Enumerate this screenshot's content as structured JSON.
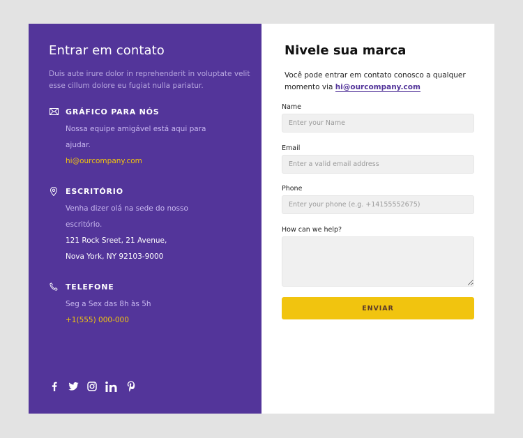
{
  "left": {
    "title": "Entrar em contato",
    "intro": "Duis aute irure dolor in reprehenderit in voluptate velit esse cillum dolore eu fugiat nulla pariatur.",
    "sections": [
      {
        "icon": "mail-icon",
        "label": "GRÁFICO PARA NÓS",
        "line1": "Nossa equipe amigável está aqui para",
        "line2": "ajudar.",
        "highlight": "hi@ourcompany.com"
      },
      {
        "icon": "map-pin-icon",
        "label": "ESCRITÓRIO",
        "line1": "Venha dizer olá na sede do nosso",
        "line2": "escritório.",
        "address1": "121 Rock Sreet, 21 Avenue,",
        "address2": "Nova York, NY 92103-9000"
      },
      {
        "icon": "phone-icon",
        "label": "TELEFONE",
        "line1": "Seg a Sex das 8h às 5h",
        "highlight": "+1(555) 000-000"
      }
    ],
    "social": [
      "facebook-icon",
      "twitter-icon",
      "instagram-icon",
      "linkedin-icon",
      "pinterest-icon"
    ]
  },
  "right": {
    "title": "Nivele sua marca",
    "intro_prefix": "Você pode entrar em contato conosco a qualquer momento via ",
    "intro_link": "hi@ourcompany.com",
    "fields": {
      "name": {
        "label": "Name",
        "placeholder": "Enter your Name",
        "value": ""
      },
      "email": {
        "label": "Email",
        "placeholder": "Enter a valid email address",
        "value": ""
      },
      "phone": {
        "label": "Phone",
        "placeholder": "Enter your phone (e.g. +14155552675)",
        "value": ""
      },
      "message": {
        "label": "How can we help?",
        "placeholder": "",
        "value": ""
      }
    },
    "submit_label": "ENVIAR"
  },
  "colors": {
    "background": "#e3e3e3",
    "panel": "#53359a",
    "accent": "#f1c40f",
    "input_bg": "#f0f0f0"
  }
}
